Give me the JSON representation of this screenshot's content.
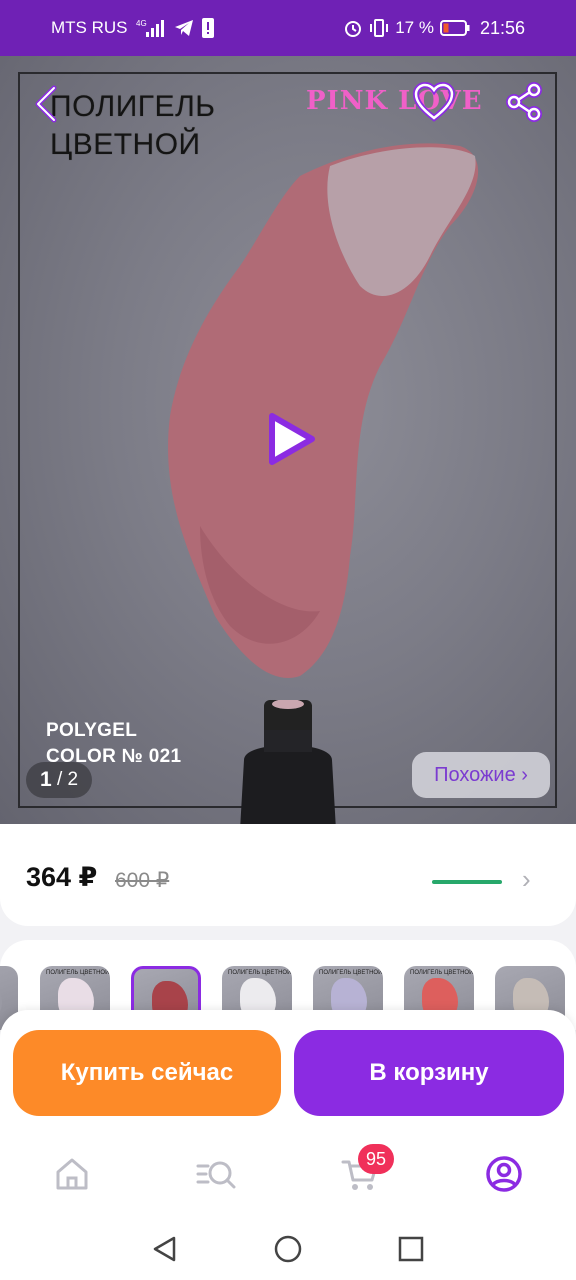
{
  "status_bar": {
    "carrier": "MTS RUS",
    "network": "4G",
    "battery_percent": "17 %",
    "time": "21:56",
    "icons": [
      "signal-icon",
      "telegram-icon",
      "notification-icon",
      "alarm-icon",
      "vibrate-icon",
      "battery-icon"
    ]
  },
  "hero": {
    "title_line1": "ПОЛИГЕЛЬ",
    "title_line2": "ЦВЕТНОЙ",
    "brand": "PINK LOVE",
    "caption_line1": "POLYGEL",
    "caption_line2": "COLOR № 021",
    "page_current": "1",
    "page_separator": " / ",
    "page_total": "2",
    "similar_label": "Похожие ›",
    "swatch_color": "#b06b76"
  },
  "price": {
    "current": "364 ₽",
    "old": "600 ₽",
    "bar_color": "#27a86b"
  },
  "thumbnails": [
    {
      "label": "",
      "color": "#9a9aa4"
    },
    {
      "label": "ПОЛИГЕЛЬ ЦВЕТНОЙ",
      "color": "#e9dde6"
    },
    {
      "label": "",
      "color": "#a8434a",
      "active": true
    },
    {
      "label": "ПОЛИГЕЛЬ ЦВЕТНОЙ",
      "color": "#ecebee"
    },
    {
      "label": "ПОЛИГЕЛЬ ЦВЕТНОЙ",
      "color": "#b7b2d4"
    },
    {
      "label": "ПОЛИГЕЛЬ ЦВЕТНОЙ",
      "color": "#dd5f5d"
    },
    {
      "label": "",
      "color": "#c5bcb6"
    }
  ],
  "actions": {
    "buy_now": "Купить сейчас",
    "add_to_cart": "В корзину",
    "buy_color": "#fd8a28",
    "cart_color": "#8b2be2"
  },
  "tabbar": {
    "items": [
      "home-icon",
      "catalog-search-icon",
      "cart-icon",
      "profile-icon"
    ],
    "cart_badge": "95",
    "active_color": "#8b2be2"
  },
  "navbar": {
    "items": [
      "back-triangle-icon",
      "home-circle-icon",
      "recents-square-icon"
    ]
  }
}
